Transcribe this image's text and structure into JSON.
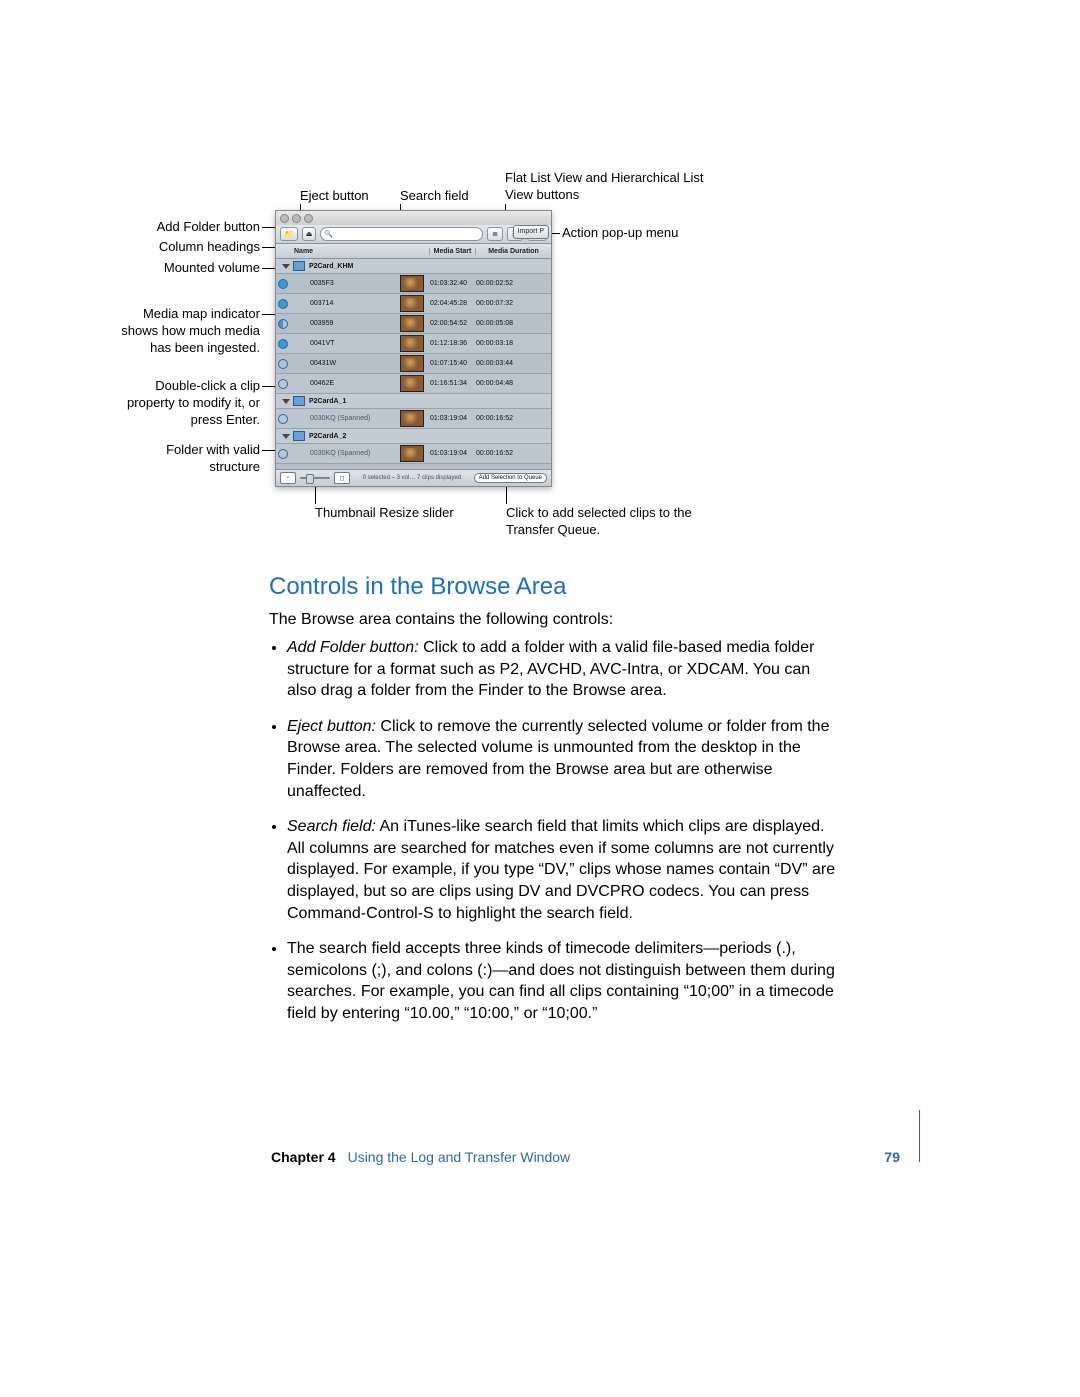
{
  "figure": {
    "labels": {
      "add_folder": "Add Folder button",
      "column_headings": "Column headings",
      "mounted_volume": "Mounted volume",
      "media_map": "Media map indicator shows how much media has been ingested.",
      "dblclick": "Double-click a clip property to modify it, or press Enter.",
      "folder_valid": "Folder with valid structure",
      "eject": "Eject button",
      "search_field": "Search field",
      "flat_hier": "Flat List View and Hierarchical List View buttons",
      "action_popup": "Action pop-up menu",
      "thumb_slider": "Thumbnail Resize slider",
      "queue_btn": "Click to add selected clips to the Transfer Queue."
    },
    "shot": {
      "import_btn": "Import P",
      "cols": {
        "name": "Name",
        "media_start": "Media Start",
        "media_duration": "Media Duration"
      },
      "vols": [
        "P2Card_KHM",
        "P2CardA_1",
        "P2CardA_2"
      ],
      "clips": [
        {
          "ind": "full",
          "name": "0035F3",
          "t1": "01:03:32:40",
          "t2": "00:00:02:52"
        },
        {
          "ind": "full",
          "name": "003714",
          "t1": "02:04:45:28",
          "t2": "00:00:07:32"
        },
        {
          "ind": "half",
          "name": "003959",
          "t1": "02:00:54:52",
          "t2": "00:00:05:08"
        },
        {
          "ind": "full",
          "name": "0041VT",
          "t1": "01:12:18:36",
          "t2": "00:00:03:18"
        },
        {
          "ind": "none",
          "name": "00431W",
          "t1": "01:07:15:40",
          "t2": "00:00:03:44"
        },
        {
          "ind": "none",
          "name": "00462E",
          "t1": "01:16:51:34",
          "t2": "00:00:04:48"
        }
      ],
      "span1": {
        "name": "0030KQ",
        "suffix": " (Spanned)",
        "t1": "01:03:19:04",
        "t2": "00:00:16:52"
      },
      "span2": {
        "name": "0030KQ",
        "suffix": " (Spanned)",
        "t1": "01:03:19:04",
        "t2": "00:00:16:52"
      },
      "footer_status": "0 selected – 3 vol… 7 clips displayed",
      "footer_queue": "Add Selection to Queue"
    }
  },
  "section": {
    "heading": "Controls in the Browse Area",
    "intro": "The Browse area contains the following controls:",
    "items": [
      {
        "term": "Add Folder button:",
        "text": "  Click to add a folder with a valid file-based media folder structure for a format such as P2, AVCHD, AVC-Intra, or XDCAM. You can also drag a folder from the Finder to the Browse area."
      },
      {
        "term": "Eject button:",
        "text": "  Click to remove the currently selected volume or folder from the Browse area. The selected volume is unmounted from the desktop in the Finder. Folders are removed from the Browse area but are otherwise unaffected."
      },
      {
        "term": "Search field:",
        "text": "  An iTunes-like search field that limits which clips are displayed. All columns are searched for matches even if some columns are not currently displayed. For example, if you type “DV,” clips whose names contain “DV” are displayed, but so are clips using DV and DVCPRO codecs. You can press Command-Control-S to highlight the search field."
      },
      {
        "term": "",
        "text": "The search field accepts three kinds of timecode delimiters—periods (.), semicolons (;), and colons (:)—and does not distinguish between them during searches. For example, you can find all clips containing “10;00” in a timecode field by entering “10.00,” “10:00,” or “10;00.”"
      }
    ]
  },
  "footer": {
    "chapter": "Chapter 4",
    "title": "Using the Log and Transfer Window",
    "page": "79"
  }
}
